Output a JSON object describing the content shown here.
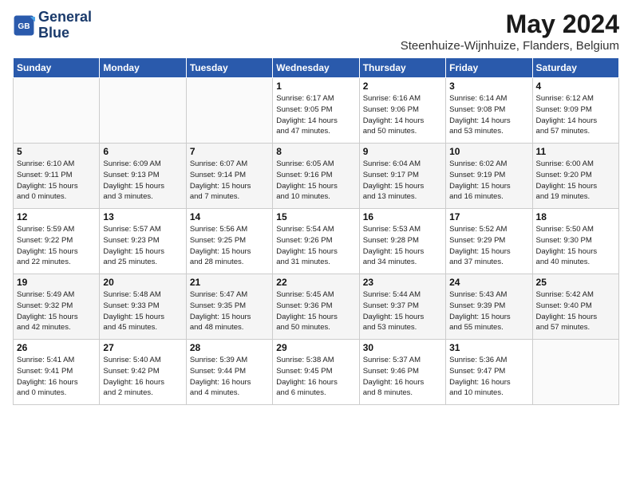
{
  "logo": {
    "line1": "General",
    "line2": "Blue"
  },
  "title": "May 2024",
  "location": "Steenhuize-Wijnhuize, Flanders, Belgium",
  "days_of_week": [
    "Sunday",
    "Monday",
    "Tuesday",
    "Wednesday",
    "Thursday",
    "Friday",
    "Saturday"
  ],
  "weeks": [
    [
      {
        "day": "",
        "info": ""
      },
      {
        "day": "",
        "info": ""
      },
      {
        "day": "",
        "info": ""
      },
      {
        "day": "1",
        "info": "Sunrise: 6:17 AM\nSunset: 9:05 PM\nDaylight: 14 hours\nand 47 minutes."
      },
      {
        "day": "2",
        "info": "Sunrise: 6:16 AM\nSunset: 9:06 PM\nDaylight: 14 hours\nand 50 minutes."
      },
      {
        "day": "3",
        "info": "Sunrise: 6:14 AM\nSunset: 9:08 PM\nDaylight: 14 hours\nand 53 minutes."
      },
      {
        "day": "4",
        "info": "Sunrise: 6:12 AM\nSunset: 9:09 PM\nDaylight: 14 hours\nand 57 minutes."
      }
    ],
    [
      {
        "day": "5",
        "info": "Sunrise: 6:10 AM\nSunset: 9:11 PM\nDaylight: 15 hours\nand 0 minutes."
      },
      {
        "day": "6",
        "info": "Sunrise: 6:09 AM\nSunset: 9:13 PM\nDaylight: 15 hours\nand 3 minutes."
      },
      {
        "day": "7",
        "info": "Sunrise: 6:07 AM\nSunset: 9:14 PM\nDaylight: 15 hours\nand 7 minutes."
      },
      {
        "day": "8",
        "info": "Sunrise: 6:05 AM\nSunset: 9:16 PM\nDaylight: 15 hours\nand 10 minutes."
      },
      {
        "day": "9",
        "info": "Sunrise: 6:04 AM\nSunset: 9:17 PM\nDaylight: 15 hours\nand 13 minutes."
      },
      {
        "day": "10",
        "info": "Sunrise: 6:02 AM\nSunset: 9:19 PM\nDaylight: 15 hours\nand 16 minutes."
      },
      {
        "day": "11",
        "info": "Sunrise: 6:00 AM\nSunset: 9:20 PM\nDaylight: 15 hours\nand 19 minutes."
      }
    ],
    [
      {
        "day": "12",
        "info": "Sunrise: 5:59 AM\nSunset: 9:22 PM\nDaylight: 15 hours\nand 22 minutes."
      },
      {
        "day": "13",
        "info": "Sunrise: 5:57 AM\nSunset: 9:23 PM\nDaylight: 15 hours\nand 25 minutes."
      },
      {
        "day": "14",
        "info": "Sunrise: 5:56 AM\nSunset: 9:25 PM\nDaylight: 15 hours\nand 28 minutes."
      },
      {
        "day": "15",
        "info": "Sunrise: 5:54 AM\nSunset: 9:26 PM\nDaylight: 15 hours\nand 31 minutes."
      },
      {
        "day": "16",
        "info": "Sunrise: 5:53 AM\nSunset: 9:28 PM\nDaylight: 15 hours\nand 34 minutes."
      },
      {
        "day": "17",
        "info": "Sunrise: 5:52 AM\nSunset: 9:29 PM\nDaylight: 15 hours\nand 37 minutes."
      },
      {
        "day": "18",
        "info": "Sunrise: 5:50 AM\nSunset: 9:30 PM\nDaylight: 15 hours\nand 40 minutes."
      }
    ],
    [
      {
        "day": "19",
        "info": "Sunrise: 5:49 AM\nSunset: 9:32 PM\nDaylight: 15 hours\nand 42 minutes."
      },
      {
        "day": "20",
        "info": "Sunrise: 5:48 AM\nSunset: 9:33 PM\nDaylight: 15 hours\nand 45 minutes."
      },
      {
        "day": "21",
        "info": "Sunrise: 5:47 AM\nSunset: 9:35 PM\nDaylight: 15 hours\nand 48 minutes."
      },
      {
        "day": "22",
        "info": "Sunrise: 5:45 AM\nSunset: 9:36 PM\nDaylight: 15 hours\nand 50 minutes."
      },
      {
        "day": "23",
        "info": "Sunrise: 5:44 AM\nSunset: 9:37 PM\nDaylight: 15 hours\nand 53 minutes."
      },
      {
        "day": "24",
        "info": "Sunrise: 5:43 AM\nSunset: 9:39 PM\nDaylight: 15 hours\nand 55 minutes."
      },
      {
        "day": "25",
        "info": "Sunrise: 5:42 AM\nSunset: 9:40 PM\nDaylight: 15 hours\nand 57 minutes."
      }
    ],
    [
      {
        "day": "26",
        "info": "Sunrise: 5:41 AM\nSunset: 9:41 PM\nDaylight: 16 hours\nand 0 minutes."
      },
      {
        "day": "27",
        "info": "Sunrise: 5:40 AM\nSunset: 9:42 PM\nDaylight: 16 hours\nand 2 minutes."
      },
      {
        "day": "28",
        "info": "Sunrise: 5:39 AM\nSunset: 9:44 PM\nDaylight: 16 hours\nand 4 minutes."
      },
      {
        "day": "29",
        "info": "Sunrise: 5:38 AM\nSunset: 9:45 PM\nDaylight: 16 hours\nand 6 minutes."
      },
      {
        "day": "30",
        "info": "Sunrise: 5:37 AM\nSunset: 9:46 PM\nDaylight: 16 hours\nand 8 minutes."
      },
      {
        "day": "31",
        "info": "Sunrise: 5:36 AM\nSunset: 9:47 PM\nDaylight: 16 hours\nand 10 minutes."
      },
      {
        "day": "",
        "info": ""
      }
    ]
  ]
}
